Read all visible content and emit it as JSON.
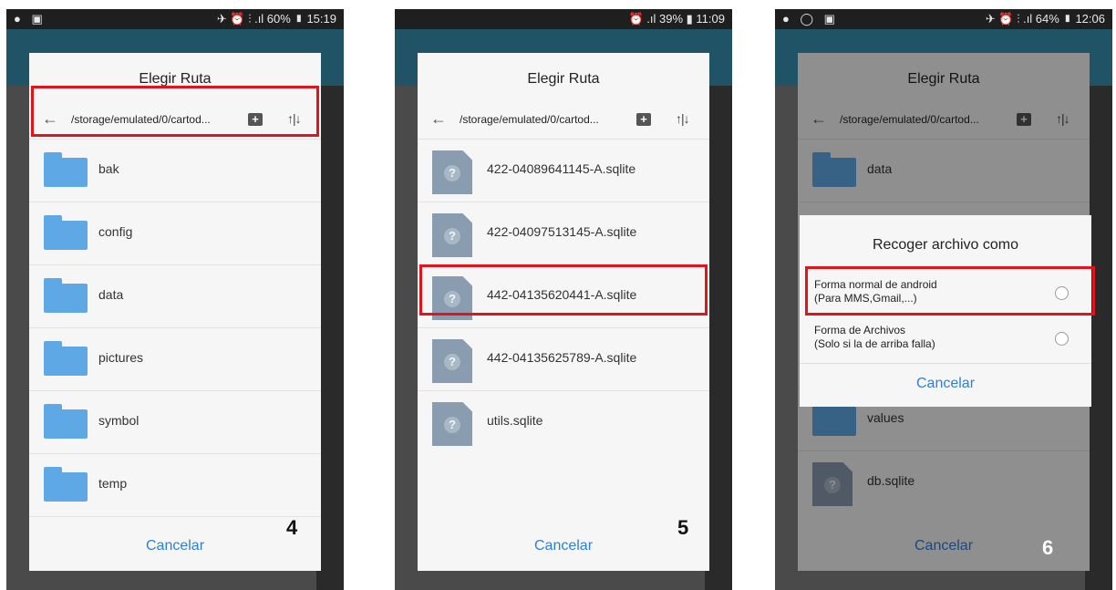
{
  "screens": [
    {
      "status": {
        "left": "● ▣",
        "right": "✈ ⏰ ⫶ .ıl 60% ▮ 15:19"
      },
      "dialog": {
        "title": "Elegir Ruta",
        "path": "/storage/emulated/0/cartod...",
        "items": [
          {
            "label": "bak",
            "icon": "folder-icon"
          },
          {
            "label": "config",
            "icon": "folder-icon"
          },
          {
            "label": "data",
            "icon": "folder-icon"
          },
          {
            "label": "pictures",
            "icon": "folder-icon"
          },
          {
            "label": "symbol",
            "icon": "folder-icon"
          },
          {
            "label": "temp",
            "icon": "folder-icon"
          }
        ],
        "cancel": "Cancelar"
      },
      "step": "4"
    },
    {
      "status": {
        "right": "⏰ .ıl 39% ▮ 11:09"
      },
      "dialog": {
        "title": "Elegir Ruta",
        "path": "/storage/emulated/0/cartod...",
        "items": [
          {
            "label": "422-04089641145-A.sqlite",
            "icon": "file-unknown-icon"
          },
          {
            "label": "422-04097513145-A.sqlite",
            "icon": "file-unknown-icon"
          },
          {
            "label": "442-04135620441-A.sqlite",
            "icon": "file-unknown-icon"
          },
          {
            "label": "442-04135625789-A.sqlite",
            "icon": "file-unknown-icon"
          },
          {
            "label": "utils.sqlite",
            "icon": "file-unknown-icon"
          }
        ],
        "cancel": "Cancelar"
      },
      "step": "5"
    },
    {
      "status": {
        "left": "● ◯ ▣",
        "right": "✈ ⏰ ⫶ .ıl 64% ▮ 12:06"
      },
      "dialog": {
        "title": "Elegir Ruta",
        "path": "/storage/emulated/0/cartod...",
        "items": [
          {
            "label": "data",
            "icon": "folder-icon"
          },
          {
            "label": "values",
            "icon": "folder-icon"
          },
          {
            "label": "db.sqlite",
            "icon": "file-unknown-icon"
          }
        ],
        "cancel": "Cancelar"
      },
      "picker": {
        "title": "Recoger archivo como",
        "options": [
          {
            "line1": "Forma normal de android",
            "line2": "(Para MMS,Gmail,...)"
          },
          {
            "line1": "Forma de Archivos",
            "line2": "(Solo si la de arriba falla)"
          }
        ],
        "cancel": "Cancelar"
      },
      "step": "6"
    }
  ]
}
